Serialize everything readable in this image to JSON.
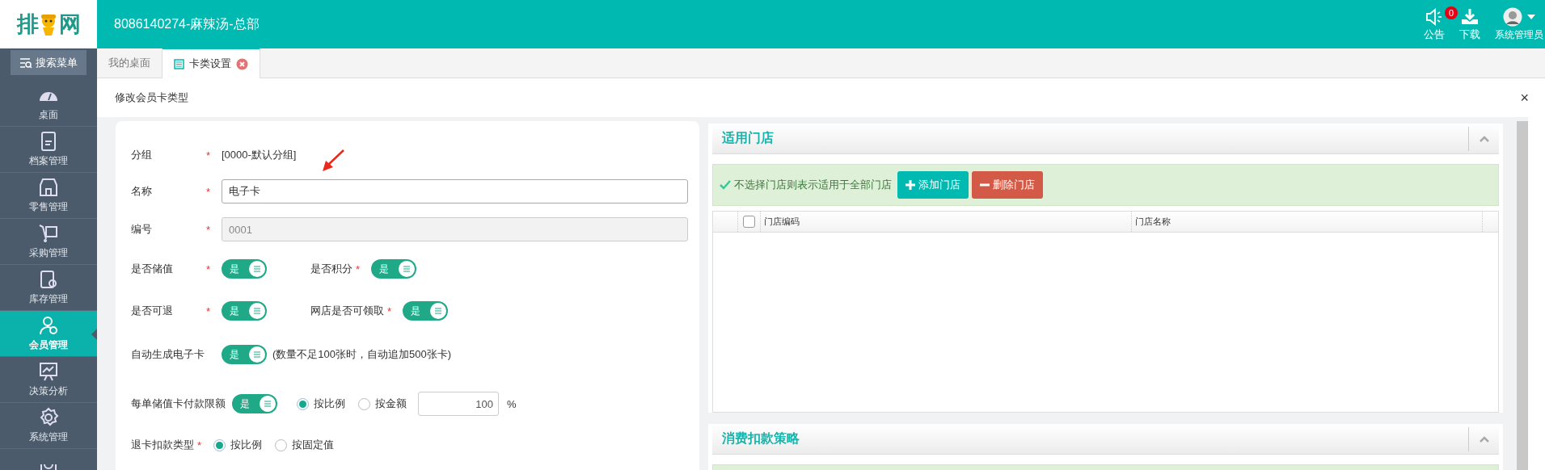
{
  "header": {
    "logo": {
      "before": "排",
      "after": "网"
    },
    "title": "8086140274-麻辣汤-总部",
    "notice": {
      "label": "公告",
      "count": "0"
    },
    "download": {
      "label": "下载"
    },
    "user": {
      "label": "系统管理员"
    }
  },
  "sidebar": {
    "search_button": "搜索菜单",
    "items": [
      {
        "label": "桌面",
        "selected": false
      },
      {
        "label": "档案管理",
        "selected": false
      },
      {
        "label": "零售管理",
        "selected": false
      },
      {
        "label": "采购管理",
        "selected": false
      },
      {
        "label": "库存管理",
        "selected": false
      },
      {
        "label": "会员管理",
        "selected": true
      },
      {
        "label": "决策分析",
        "selected": false
      },
      {
        "label": "系统管理",
        "selected": false
      }
    ]
  },
  "tabs": [
    {
      "label": "我的桌面",
      "selected": false,
      "closable": false
    },
    {
      "label": "卡类设置",
      "selected": true,
      "closable": true
    }
  ],
  "dialog": {
    "title": "修改会员卡类型",
    "close": "×"
  },
  "form": {
    "required_mark": "*",
    "rows": [
      {
        "kind": "static",
        "label": "分组",
        "required": true,
        "value": "[0000-默认分组]"
      },
      {
        "kind": "input",
        "label": "名称",
        "required": true,
        "value": "电子卡",
        "disabled": false
      },
      {
        "kind": "input",
        "label": "编号",
        "required": true,
        "value": "0001",
        "disabled": true
      },
      {
        "kind": "toggles",
        "items": [
          {
            "label": "是否储值",
            "required": true,
            "on": true,
            "text": "是"
          },
          {
            "label": "是否积分",
            "required": true,
            "on": true,
            "text": "是"
          }
        ]
      },
      {
        "kind": "toggles",
        "items": [
          {
            "label": "是否可退",
            "required": true,
            "on": true,
            "text": "是"
          },
          {
            "label": "网店是否可领取",
            "required": true,
            "on": true,
            "text": "是"
          }
        ]
      },
      {
        "kind": "toggle_note",
        "label": "自动生成电子卡",
        "toggle": {
          "on": true,
          "text": "是"
        },
        "note": "(数量不足100张时，自动追加500张卡)"
      },
      {
        "kind": "limit",
        "label": "每单储值卡付款限额",
        "toggle": {
          "on": true,
          "text": "是"
        },
        "options": [
          {
            "label": "按比例",
            "selected": true
          },
          {
            "label": "按金额",
            "selected": false
          }
        ],
        "value": "100",
        "unit": "%"
      },
      {
        "kind": "radio",
        "label": "退卡扣款类型",
        "required": true,
        "options": [
          {
            "label": "按比例",
            "selected": true
          },
          {
            "label": "按固定值",
            "selected": false
          }
        ]
      }
    ]
  },
  "stores": {
    "title": "适用门店",
    "expanded": true,
    "tip": "不选择门店则表示适用于全部门店",
    "buttons": [
      {
        "label": "添加门店",
        "kind": "add"
      },
      {
        "label": "删除门店",
        "kind": "delete"
      }
    ],
    "table": {
      "all_checked": false,
      "columns": [
        "门店编码",
        "门店名称"
      ]
    }
  },
  "deduction": {
    "title": "消费扣款策略",
    "expanded": true
  }
}
